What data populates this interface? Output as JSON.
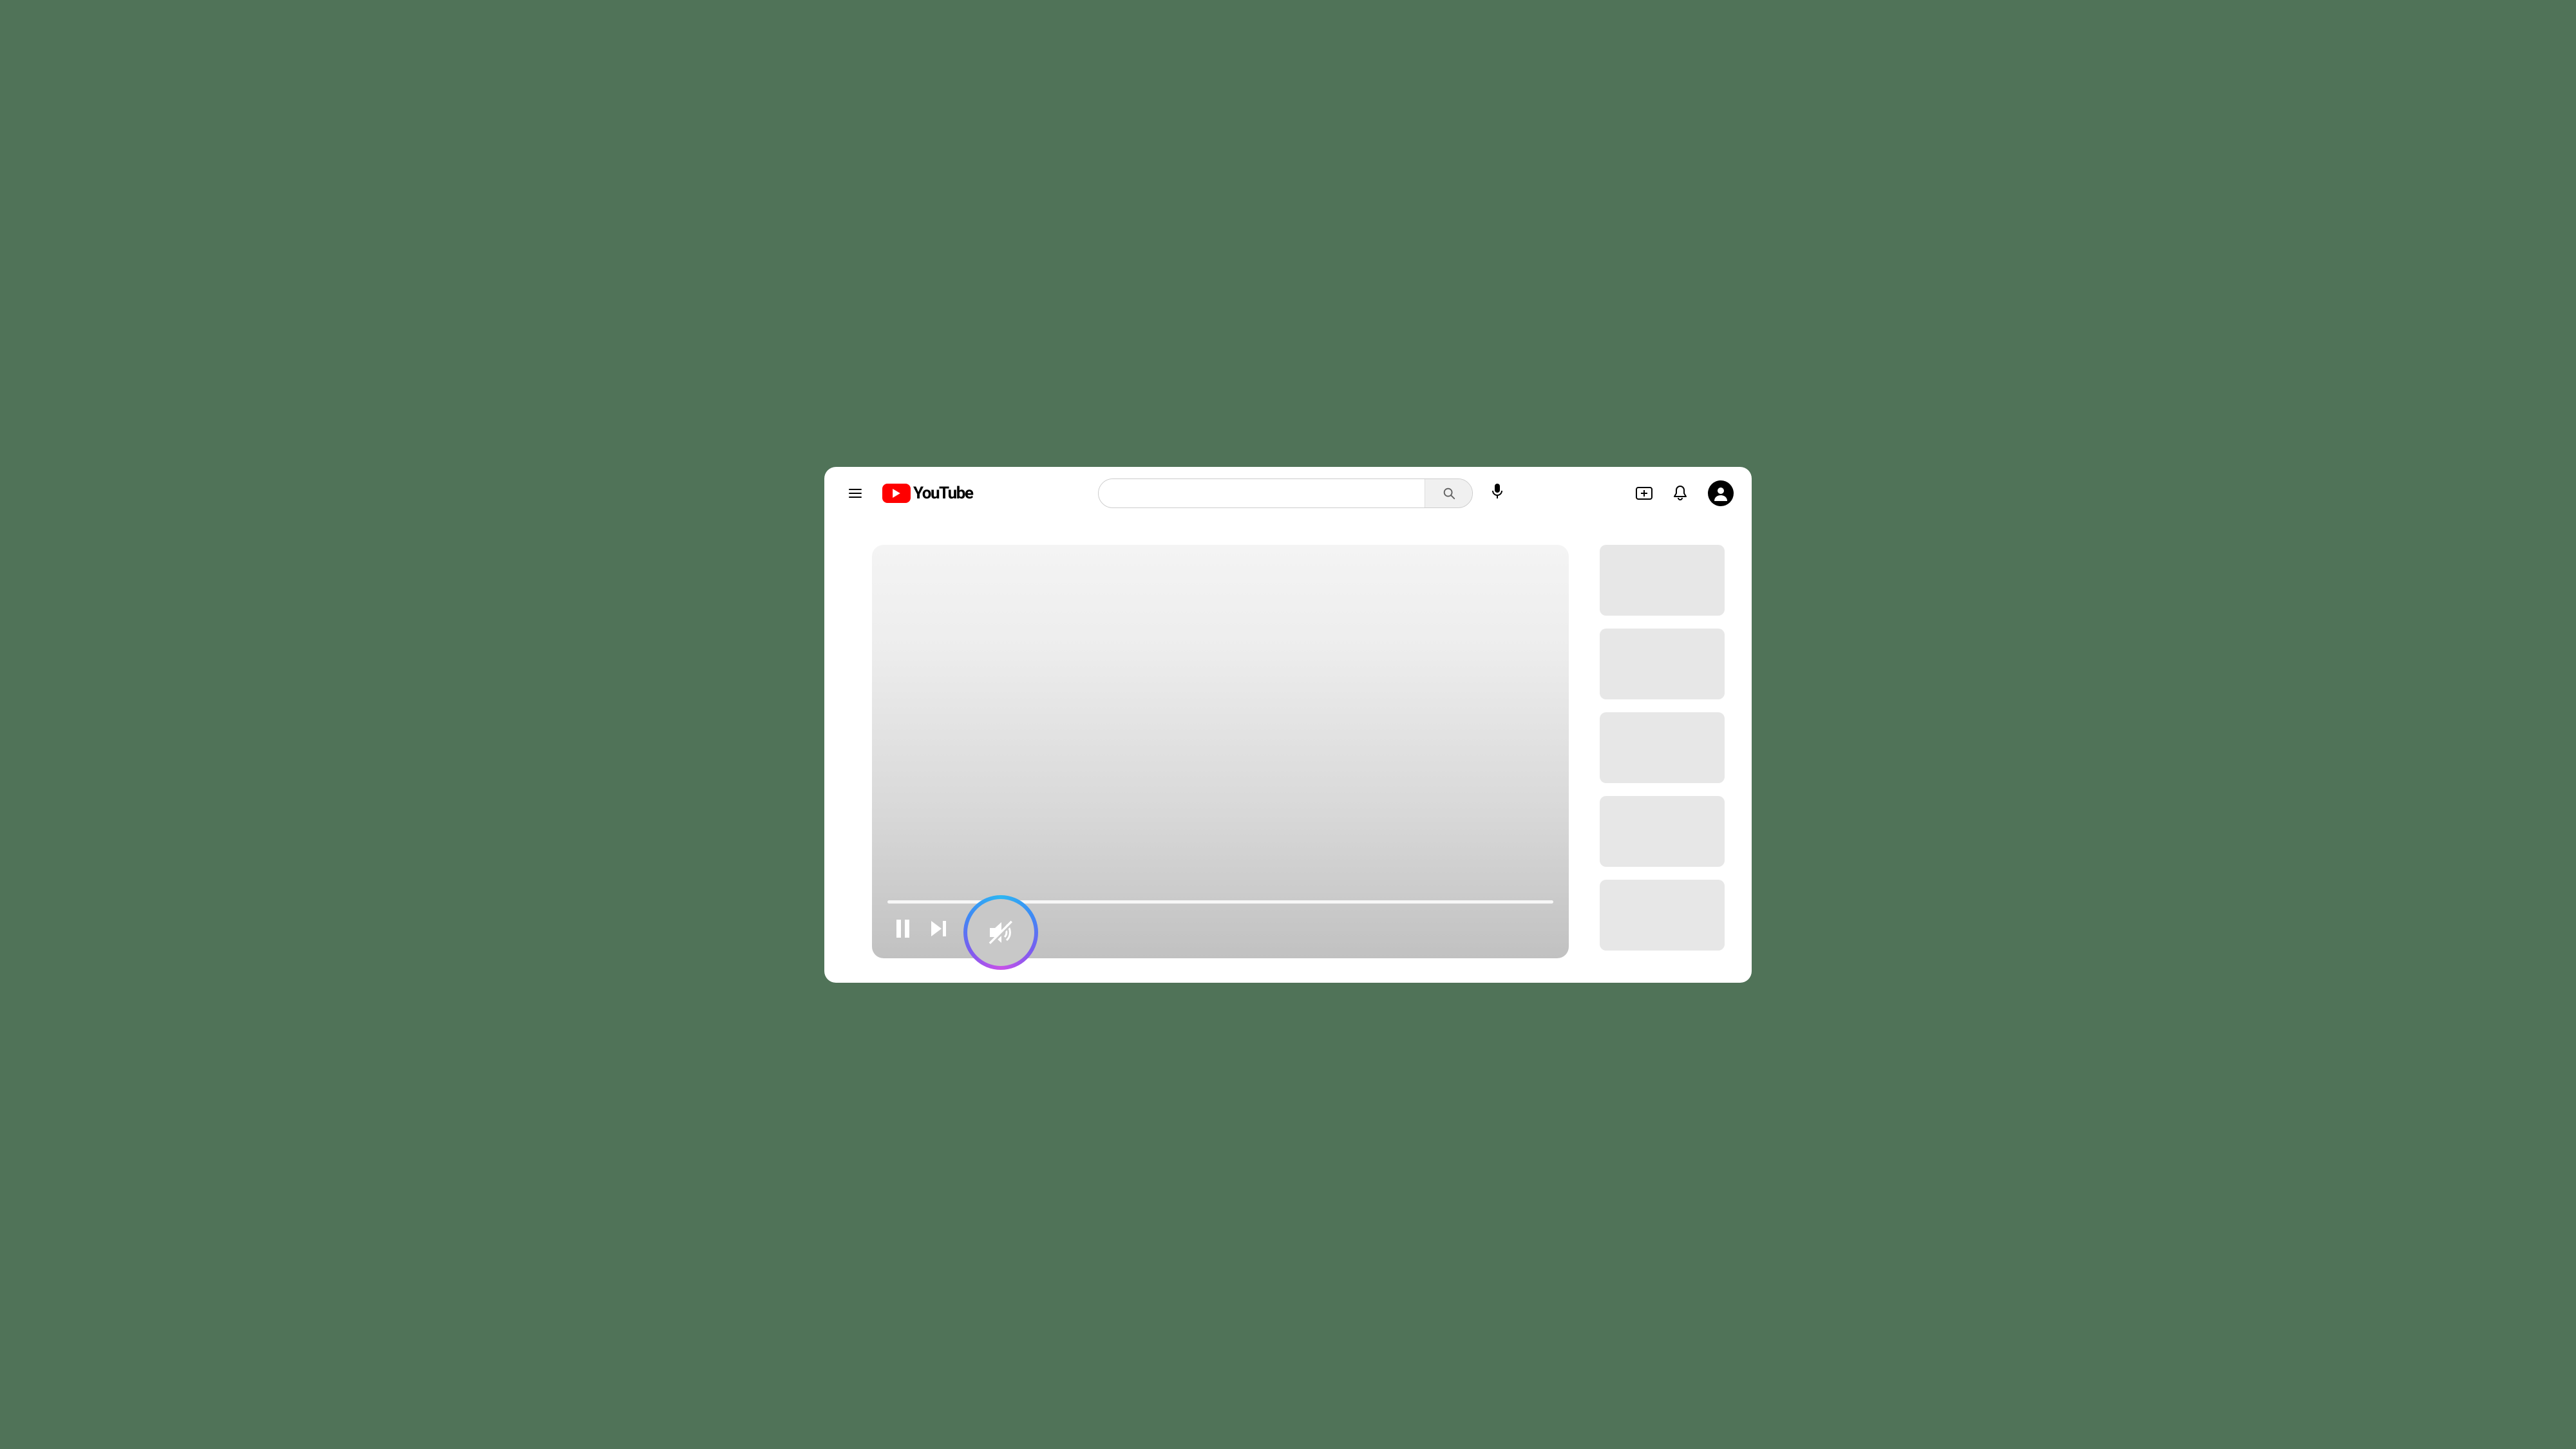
{
  "brand": {
    "name": "YouTube"
  },
  "search": {
    "placeholder": ""
  },
  "icons": {
    "menu": "menu-icon",
    "search": "search-icon",
    "mic": "microphone-icon",
    "create": "create-icon",
    "notifications": "bell-icon",
    "account": "account-icon",
    "pause": "pause-icon",
    "next": "next-icon",
    "mute": "mute-icon"
  },
  "player": {
    "state": "paused",
    "muted": true,
    "highlight": "mute"
  },
  "sidebar": {
    "suggested_count": 5
  }
}
